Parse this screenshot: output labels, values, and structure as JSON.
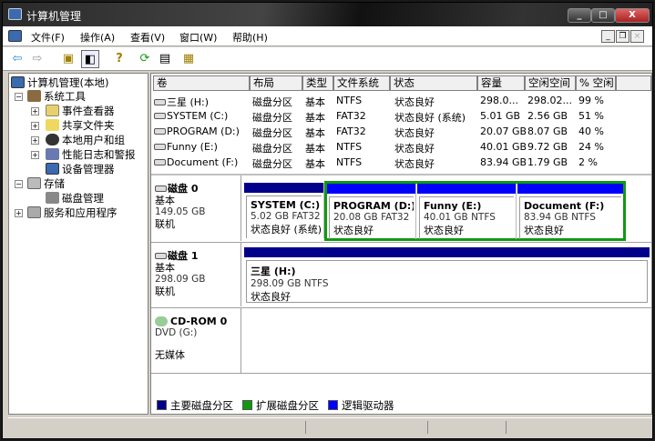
{
  "window": {
    "title": "计算机管理",
    "controls": [
      "minimize",
      "maximize",
      "close"
    ]
  },
  "menu": {
    "items": [
      "文件(F)",
      "操作(A)",
      "查看(V)",
      "窗口(W)",
      "帮助(H)"
    ]
  },
  "toolbar": {
    "icons": [
      "back-icon",
      "forward-icon",
      "up-folder-icon",
      "show-hide-tree-icon",
      "help-icon",
      "refresh-icon",
      "properties-icon",
      "console-icon"
    ]
  },
  "tree": {
    "root": "计算机管理(本地)",
    "system_tools": "系统工具",
    "event_viewer": "事件查看器",
    "shared_folders": "共享文件夹",
    "local_users": "本地用户和组",
    "perf_logs": "性能日志和警报",
    "device_manager": "设备管理器",
    "storage": "存储",
    "disk_management": "磁盘管理",
    "services_apps": "服务和应用程序"
  },
  "volumes": {
    "columns": [
      "卷",
      "布局",
      "类型",
      "文件系统",
      "状态",
      "容量",
      "空闲空间",
      "% 空闲"
    ],
    "rows": [
      [
        "三星 (H:)",
        "磁盘分区",
        "基本",
        "NTFS",
        "状态良好",
        "298.0...",
        "298.02...",
        "99 %"
      ],
      [
        "SYSTEM (C:)",
        "磁盘分区",
        "基本",
        "FAT32",
        "状态良好 (系统)",
        "5.01 GB",
        "2.56 GB",
        "51 %"
      ],
      [
        "PROGRAM (D:)",
        "磁盘分区",
        "基本",
        "FAT32",
        "状态良好",
        "20.07 GB",
        "8.07 GB",
        "40 %"
      ],
      [
        "Funny (E:)",
        "磁盘分区",
        "基本",
        "NTFS",
        "状态良好",
        "40.01 GB",
        "9.72 GB",
        "24 %"
      ],
      [
        "Document (F:)",
        "磁盘分区",
        "基本",
        "NTFS",
        "状态良好",
        "83.94 GB",
        "1.79 GB",
        "2 %"
      ]
    ]
  },
  "disks": [
    {
      "name": "磁盘 0",
      "type": "基本",
      "size": "149.05 GB",
      "status": "联机",
      "partitions": [
        {
          "name": "SYSTEM  (C:)",
          "info": "5.02 GB FAT32",
          "status": "状态良好 (系统)",
          "kind": "primary"
        },
        {
          "name": "PROGRAM  (D:)",
          "info": "20.08 GB FAT32",
          "status": "状态良好",
          "kind": "logical"
        },
        {
          "name": "Funny  (E:)",
          "info": "40.01 GB NTFS",
          "status": "状态良好",
          "kind": "logical"
        },
        {
          "name": "Document  (F:)",
          "info": "83.94 GB NTFS",
          "status": "状态良好",
          "kind": "logical"
        }
      ]
    },
    {
      "name": "磁盘 1",
      "type": "基本",
      "size": "298.09 GB",
      "status": "联机",
      "partitions": [
        {
          "name": "三星  (H:)",
          "info": "298.09 GB NTFS",
          "status": "状态良好",
          "kind": "primary"
        }
      ]
    },
    {
      "name": "CD-ROM 0",
      "type": "DVD (G:)",
      "status": "无媒体"
    }
  ],
  "legend": [
    {
      "label": "主要磁盘分区",
      "color": "#00008b"
    },
    {
      "label": "扩展磁盘分区",
      "color": "#008000"
    },
    {
      "label": "逻辑驱动器",
      "color": "#0000ff"
    }
  ],
  "colors": {
    "primary": "#00008b",
    "extended": "#119911",
    "logical": "#0000ff"
  }
}
